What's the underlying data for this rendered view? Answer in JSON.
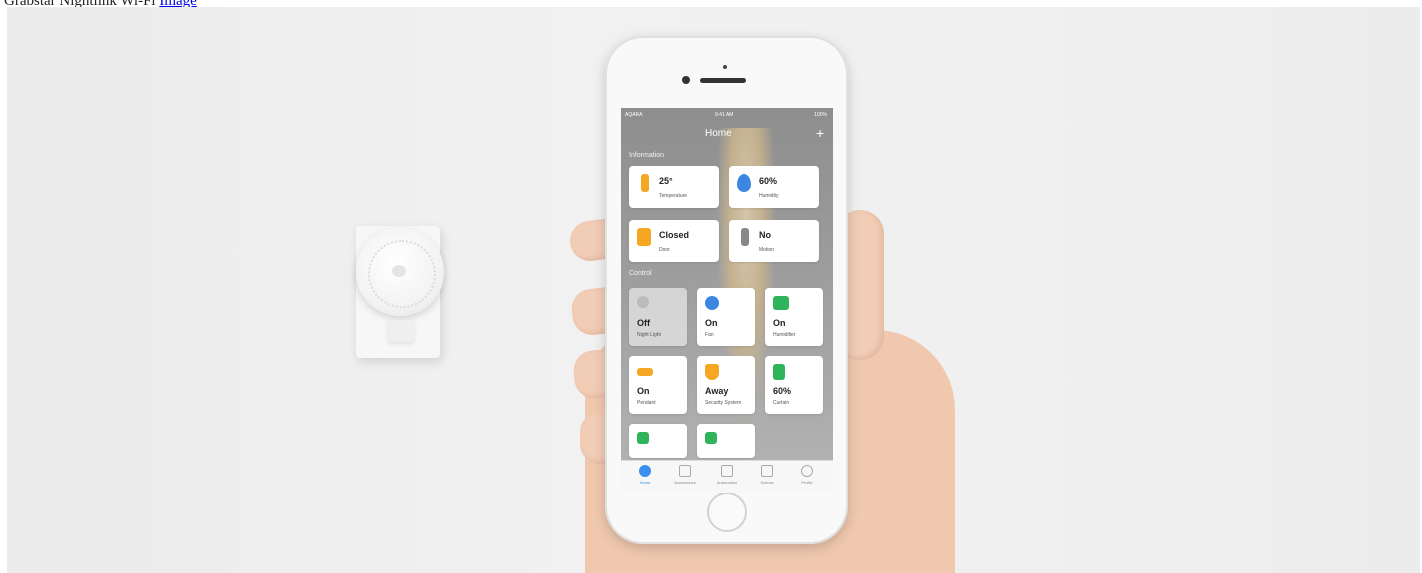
{
  "caption": {
    "text": "Grabstar Nightlink Wi-Fi",
    "link": "Image"
  },
  "phone": {
    "status": {
      "carrier": "AQARA",
      "time": "9:41 AM",
      "battery": "100%"
    },
    "title": "Home",
    "add": "+",
    "sections": {
      "information": "Information",
      "control": "Control"
    },
    "info_cards": [
      {
        "value": "25°",
        "label": "Temperature",
        "icon": "thermometer-icon"
      },
      {
        "value": "60%",
        "label": "Humidity",
        "icon": "water-drop-icon"
      },
      {
        "value": "Closed",
        "label": "Door",
        "icon": "door-icon"
      },
      {
        "value": "No",
        "label": "Motion",
        "icon": "motion-icon"
      }
    ],
    "control_cards": [
      {
        "value": "Off",
        "label": "Night Light",
        "icon": "bulb-icon"
      },
      {
        "value": "On",
        "label": "Fan",
        "icon": "fan-icon"
      },
      {
        "value": "On",
        "label": "Humidifier",
        "icon": "humidifier-icon"
      },
      {
        "value": "On",
        "label": "Pendant",
        "icon": "pendant-lamp-icon"
      },
      {
        "value": "Away",
        "label": "Security System",
        "icon": "shield-icon"
      },
      {
        "value": "60%",
        "label": "Curtain",
        "icon": "curtain-icon"
      }
    ],
    "tabs": [
      "Home",
      "Accessories",
      "Automation",
      "Scenes",
      "Profile"
    ]
  },
  "colors": {
    "accent": "#3b8ff0",
    "orange": "#f5a623",
    "green": "#2fb45c",
    "blue": "#3a86e0"
  }
}
